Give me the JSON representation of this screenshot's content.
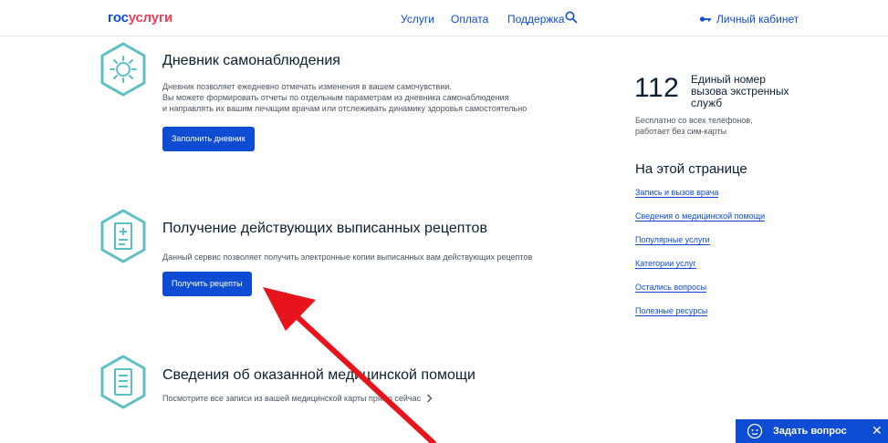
{
  "header": {
    "logo_part1": "гос",
    "logo_part2": "услуги",
    "nav": [
      "Услуги",
      "Оплата",
      "Поддержка"
    ],
    "cabinet_label": "Личный кабинет"
  },
  "sections": {
    "diary": {
      "title": "Дневник самонаблюдения",
      "text": [
        "Дневник позволяет ежедневно отмечать изменения в вашем самочувствии.",
        "Вы можете формировать отчеты по отдельным параметрам из дневника самонаблюдения",
        "и направлять их вашим лечащим врачам или отслеживать динамику здоровья самостоятельно"
      ],
      "button": "Заполнить дневник"
    },
    "recipes": {
      "title": "Получение действующих выписанных рецептов",
      "text": "Данный сервис позволяет получить электронные копии выписанных вам действующих рецептов",
      "button": "Получить рецепты"
    },
    "records": {
      "title": "Сведения об оказанной медицинской помощи",
      "text": "Посмотрите все записи из вашей медицинской карты прямо сейчас"
    }
  },
  "emergency": {
    "number": "112",
    "label": "Единый номер вызова экстренных служб",
    "note": "Бесплатно со всех телефонов, работает без сим-карты"
  },
  "on_page": {
    "title": "На этой странице",
    "links": [
      "Запись и вызов врача",
      "Сведения о медицинской помощи",
      "Популярные услуги",
      "Категории услуг",
      "Остались вопросы",
      "Полезные ресурсы"
    ]
  },
  "chat": {
    "label": "Задать вопрос",
    "close": "✕"
  },
  "colors": {
    "brand_blue": "#0d4cd3",
    "brand_red": "#ee3f58",
    "icon_teal": "#5bbfc6",
    "annotation_red": "#e8141b"
  }
}
